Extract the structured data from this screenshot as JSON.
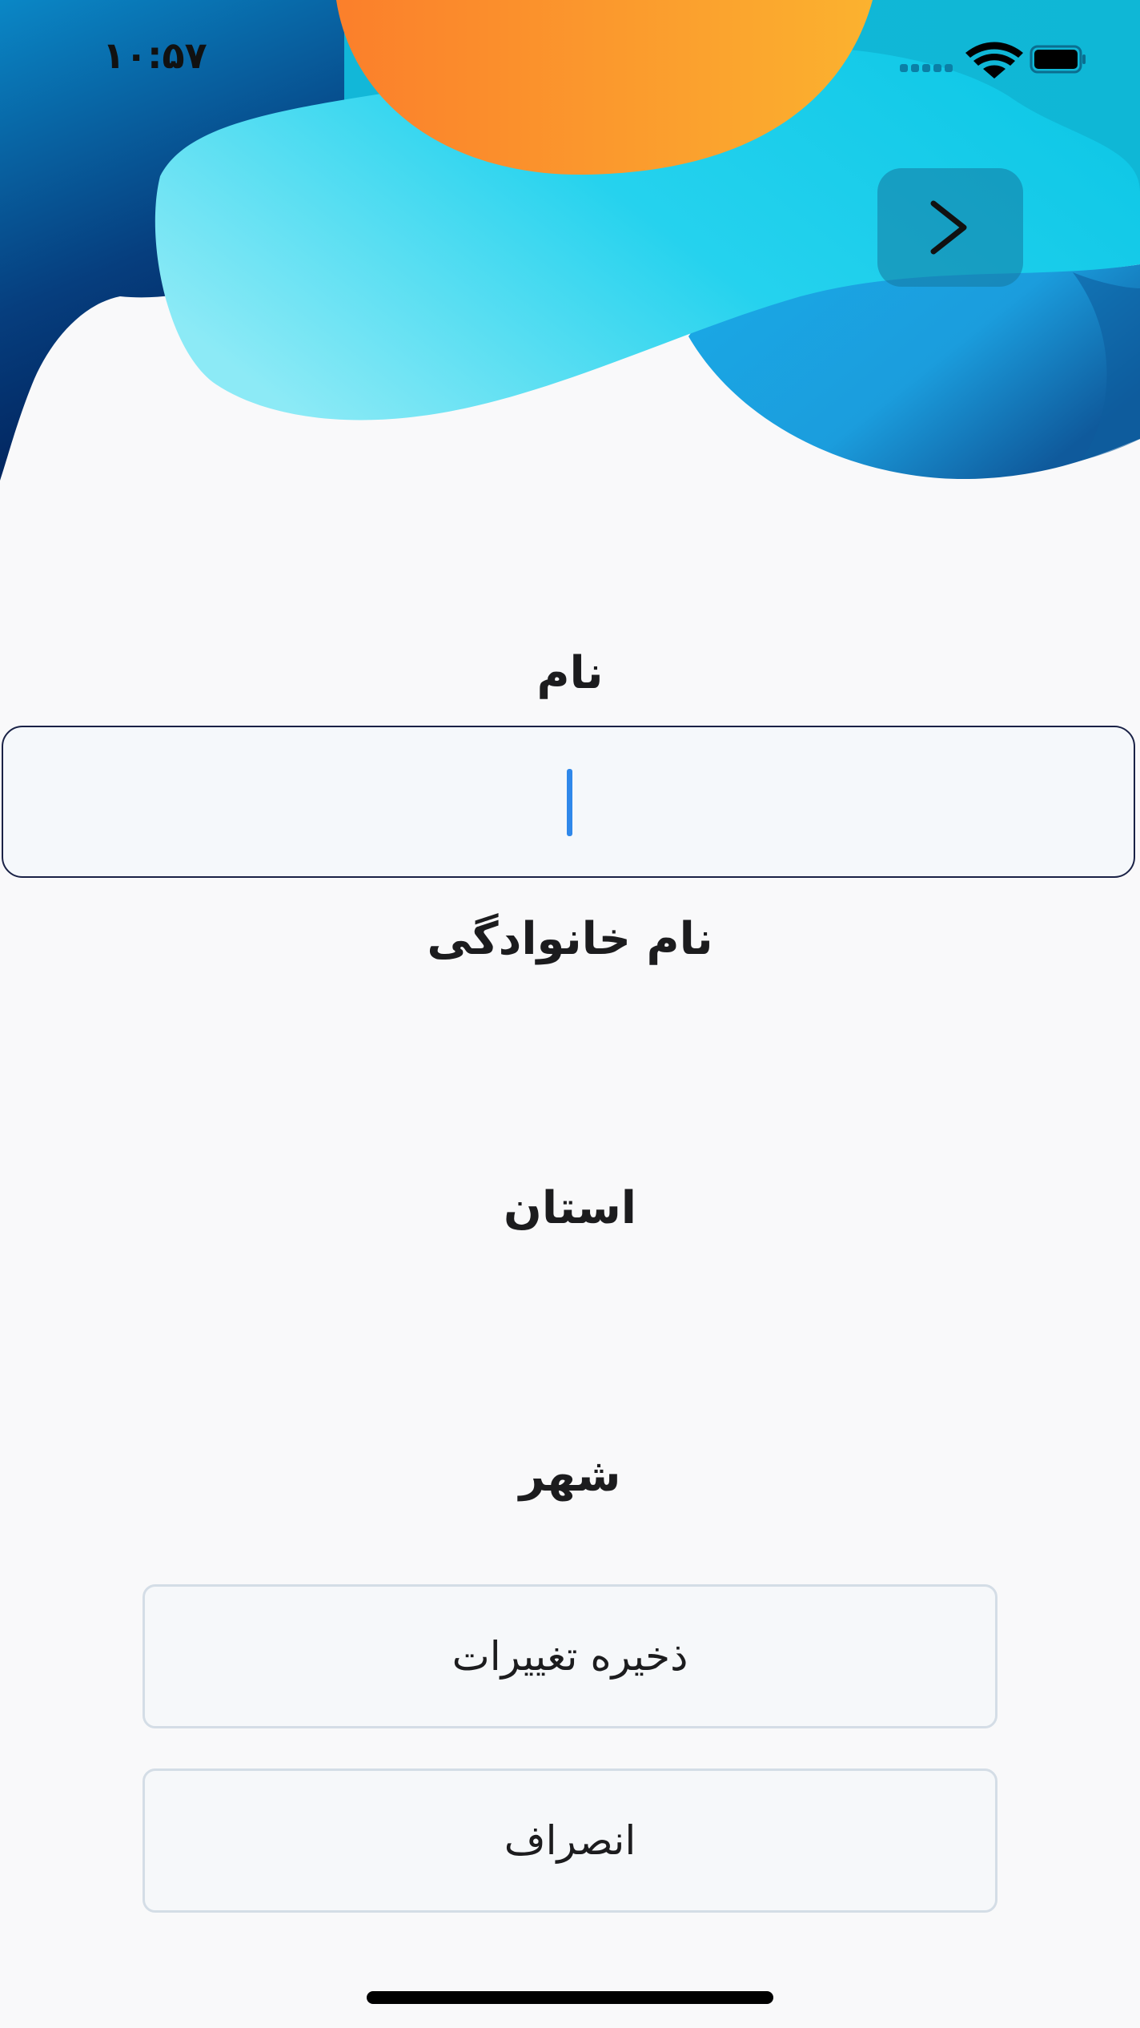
{
  "status_bar": {
    "time": "۱۰:۵۷",
    "signal_icon": "cellular-dots-icon",
    "wifi_icon": "wifi-icon",
    "battery_icon": "battery-icon"
  },
  "header": {
    "back_icon": "chevron-right-icon"
  },
  "form": {
    "first_name_label": "نام",
    "first_name_value": "",
    "last_name_label": "نام خانوادگی",
    "last_name_value": "",
    "province_label": "استان",
    "province_value": "",
    "city_label": "شهر",
    "city_value": ""
  },
  "actions": {
    "save_label": "ذخیره تغییرات",
    "cancel_label": "انصراف"
  },
  "colors": {
    "background": "#f9f9fa",
    "input_border": "#1a2246",
    "caret": "#2f88ea",
    "button_border": "#d4dde6"
  }
}
